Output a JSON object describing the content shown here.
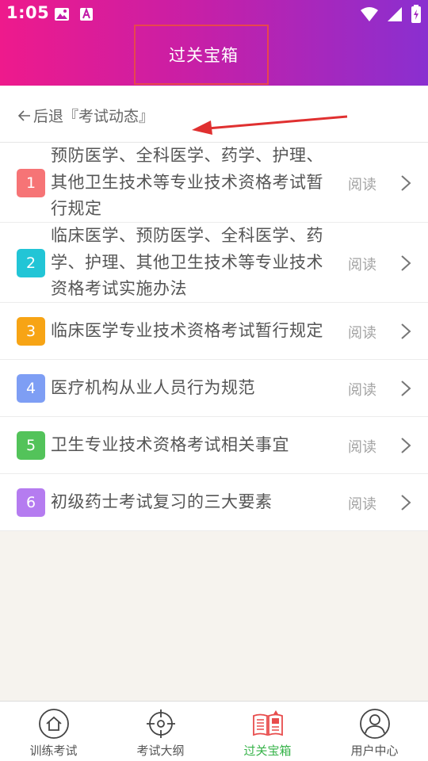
{
  "status_bar": {
    "time": "1:05"
  },
  "header": {
    "title": "过关宝箱"
  },
  "back": {
    "label": "后退『考试动态』"
  },
  "list": [
    {
      "num": "1",
      "color": "#f67476",
      "title": "预防医学、全科医学、药学、护理、其他卫生技术等专业技术资格考试暂行规定",
      "action": "阅读"
    },
    {
      "num": "2",
      "color": "#22c5d6",
      "title": "临床医学、预防医学、全科医学、药学、护理、其他卫生技术等专业技术资格考试实施办法",
      "action": "阅读"
    },
    {
      "num": "3",
      "color": "#f7a415",
      "title": "临床医学专业技术资格考试暂行规定",
      "action": "阅读"
    },
    {
      "num": "4",
      "color": "#7e9ef4",
      "title": "医疗机构从业人员行为规范",
      "action": "阅读"
    },
    {
      "num": "5",
      "color": "#53c35a",
      "title": "卫生专业技术资格考试相关事宜",
      "action": "阅读"
    },
    {
      "num": "6",
      "color": "#b57cf0",
      "title": "初级药士考试复习的三大要素",
      "action": "阅读"
    }
  ],
  "bottom_nav": [
    {
      "label": "训练考试",
      "icon": "home-icon",
      "active": false
    },
    {
      "label": "考试大纲",
      "icon": "target-icon",
      "active": false
    },
    {
      "label": "过关宝箱",
      "icon": "book-icon",
      "active": true
    },
    {
      "label": "用户中心",
      "icon": "user-icon",
      "active": false
    }
  ],
  "colors": {
    "accent_active": "#37b34a",
    "annotation": "#e03030"
  }
}
